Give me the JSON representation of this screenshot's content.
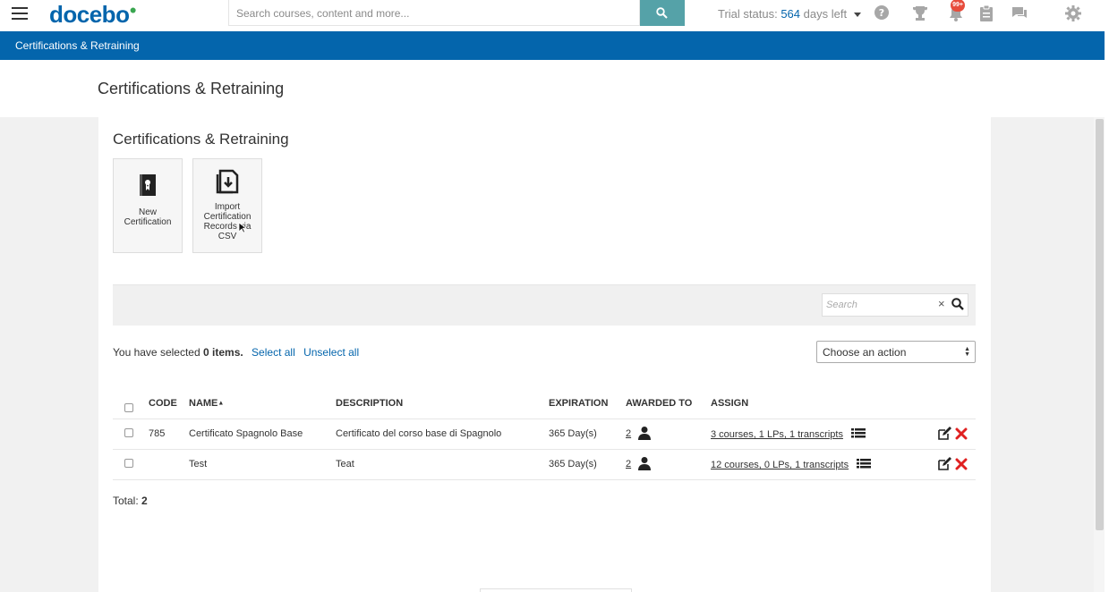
{
  "header": {
    "logo": "docebo",
    "search_placeholder": "Search courses, content and more...",
    "trial_label": "Trial status:",
    "trial_days": "564",
    "trial_suffix": "days left",
    "notification_badge": "99+"
  },
  "breadcrumb": {
    "item": "Certifications & Retraining"
  },
  "page": {
    "title": "Certifications & Retraining",
    "section_title": "Certifications & Retraining"
  },
  "tiles": [
    {
      "label_line1": "New",
      "label_line2": "Certification"
    },
    {
      "label_line1": "Import",
      "label_line2": "Certification",
      "label_line3": "Records via",
      "label_line4": "CSV"
    }
  ],
  "filter": {
    "placeholder": "Search",
    "clear": "×"
  },
  "selection": {
    "prefix": "You have selected",
    "count": "0",
    "suffix": "items.",
    "select_all": "Select all",
    "unselect_all": "Unselect all"
  },
  "action_select": {
    "value": "Choose an action"
  },
  "table": {
    "headers": {
      "code": "CODE",
      "name": "NAME",
      "sort_indicator": "▲",
      "description": "DESCRIPTION",
      "expiration": "EXPIRATION",
      "awarded_to": "AWARDED TO",
      "assign": "ASSIGN"
    },
    "rows": [
      {
        "code": "785",
        "name": "Certificato Spagnolo Base",
        "description": "Certificato del corso base di Spagnolo",
        "expiration": "365 Day(s)",
        "awarded": "2",
        "assign": "3 courses, 1 LPs, 1 transcripts"
      },
      {
        "code": "",
        "name": "Test",
        "description": "Teat",
        "expiration": "365 Day(s)",
        "awarded": "2",
        "assign": "12 courses, 0 LPs, 1 transcripts"
      }
    ]
  },
  "total": {
    "label": "Total:",
    "value": "2"
  },
  "colors": {
    "brand_blue": "#0465ac",
    "search_button": "#55a2a8",
    "delete_red": "#e02020",
    "badge_red": "#e74c3c"
  }
}
